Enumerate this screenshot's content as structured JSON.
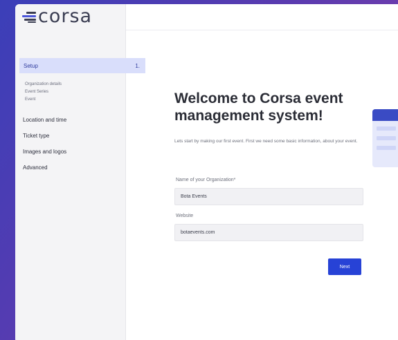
{
  "app": {
    "logo_text": "corsa"
  },
  "sidebar": {
    "active_item": {
      "label": "Setup",
      "step": "1."
    },
    "sub_items": [
      {
        "label": "Organization details"
      },
      {
        "label": "Event Series"
      },
      {
        "label": "Event"
      }
    ],
    "items": [
      {
        "label": "Location and time"
      },
      {
        "label": "Ticket type"
      },
      {
        "label": "Images and logos"
      },
      {
        "label": "Advanced"
      }
    ]
  },
  "main": {
    "title": "Welcome to Corsa event management system!",
    "intro": "Lets start by making our first event. First we need some basic information, about your event.",
    "org_field": {
      "label": "Name of your Organization*",
      "value": "Bota Events"
    },
    "website_field": {
      "label": "Website",
      "value": "botaevents.com"
    },
    "next_label": "Next"
  },
  "colors": {
    "accent": "#2742d6",
    "sidebar_active_bg": "#d9defb",
    "background_gradient_start": "#3b3fb8",
    "background_gradient_end": "#8a3ea8"
  }
}
